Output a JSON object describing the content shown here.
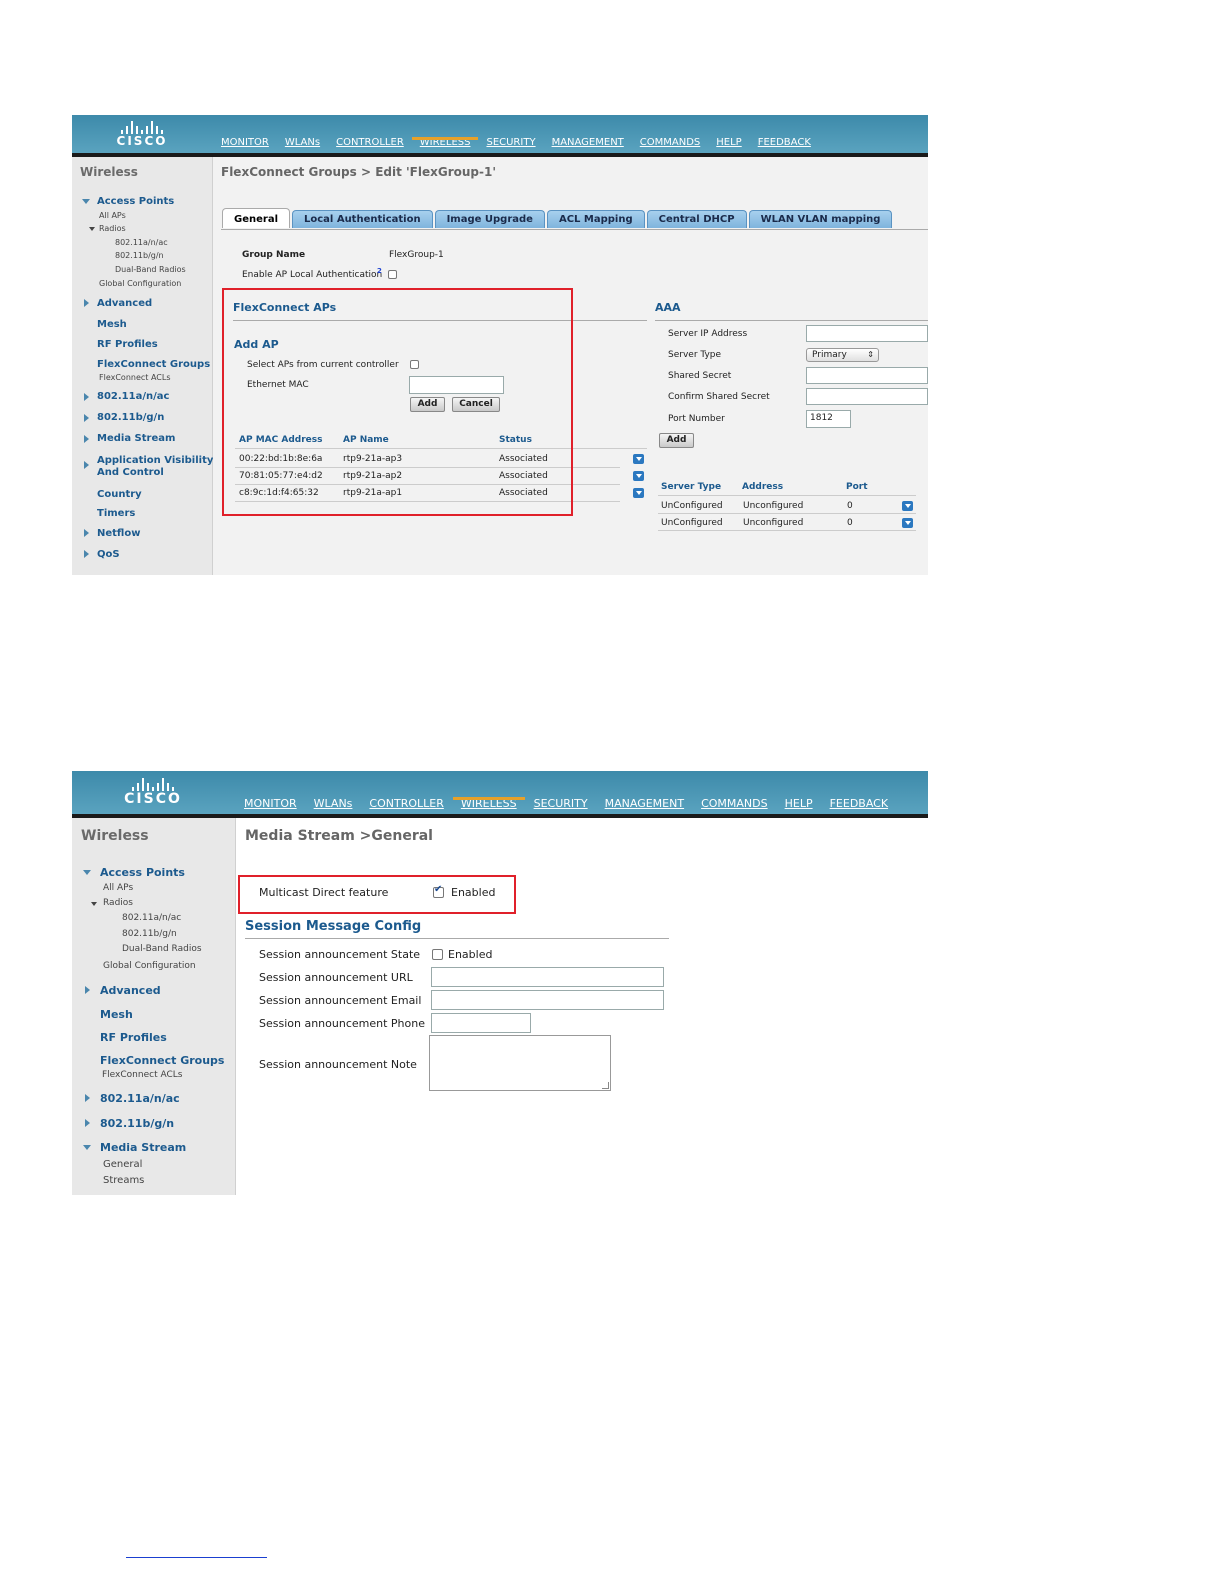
{
  "header": {
    "logo_text": "CISCO",
    "nav": [
      "MONITOR",
      "WLANs",
      "CONTROLLER",
      "WIRELESS",
      "SECURITY",
      "MANAGEMENT",
      "COMMANDS",
      "HELP",
      "FEEDBACK"
    ],
    "active_nav": "WIRELESS"
  },
  "sidebar": {
    "title": "Wireless",
    "access_points": "Access Points",
    "all_aps": "All APs",
    "radios": "Radios",
    "radio_ac": "802.11a/n/ac",
    "radio_bgn": "802.11b/g/n",
    "dual_band": "Dual-Band Radios",
    "global_config": "Global Configuration",
    "advanced": "Advanced",
    "mesh": "Mesh",
    "rf_profiles": "RF Profiles",
    "flexconnect_groups": "FlexConnect Groups",
    "flexconnect_acls": "FlexConnect ACLs",
    "band_a": "802.11a/n/ac",
    "band_b": "802.11b/g/n",
    "media_stream": "Media Stream",
    "app_visibility_1": "Application Visibility",
    "app_visibility_2": "And Control",
    "country": "Country",
    "timers": "Timers",
    "netflow": "Netflow",
    "qos": "QoS",
    "ms_general": "General",
    "ms_streams": "Streams"
  },
  "screen1": {
    "title": "FlexConnect Groups > Edit   'FlexGroup-1'",
    "tabs": [
      "General",
      "Local Authentication",
      "Image Upgrade",
      "ACL Mapping",
      "Central DHCP",
      "WLAN VLAN mapping"
    ],
    "group_name_label": "Group Name",
    "group_name_value": "FlexGroup-1",
    "enable_local_auth": "Enable AP Local Authentication",
    "footnote_mark": "2",
    "flexconnect_aps": "FlexConnect APs",
    "add_ap": "Add AP",
    "select_aps_label": "Select APs from current controller",
    "ethernet_mac_label": "Ethernet MAC",
    "add_button": "Add",
    "cancel_button": "Cancel",
    "table_headers": [
      "AP MAC Address",
      "AP Name",
      "Status"
    ],
    "table_rows": [
      [
        "00:22:bd:1b:8e:6a",
        "rtp9-21a-ap3",
        "Associated"
      ],
      [
        "70:81:05:77:e4:d2",
        "rtp9-21a-ap2",
        "Associated"
      ],
      [
        "c8:9c:1d:f4:65:32",
        "rtp9-21a-ap1",
        "Associated"
      ]
    ],
    "aaa": {
      "title": "AAA",
      "server_ip": "Server IP Address",
      "server_type": "Server Type",
      "server_type_value": "Primary",
      "shared_secret": "Shared Secret",
      "confirm_secret": "Confirm Shared Secret",
      "port_number": "Port Number",
      "port_value": "1812",
      "add_button": "Add",
      "headers": [
        "Server Type",
        "Address",
        "Port"
      ],
      "rows": [
        [
          "UnConfigured",
          "Unconfigured",
          "0"
        ],
        [
          "UnConfigured",
          "Unconfigured",
          "0"
        ]
      ]
    }
  },
  "screen2": {
    "title": "Media Stream >General",
    "multicast_label": "Multicast Direct feature",
    "multicast_enabled": "Enabled",
    "session_config_title": "Session Message Config",
    "state_label": "Session announcement State",
    "state_enabled": "Enabled",
    "url_label": "Session announcement URL",
    "email_label": "Session announcement Email",
    "phone_label": "Session announcement Phone",
    "note_label": "Session announcement Note"
  },
  "colors": {
    "header_blue": "#4a96b5",
    "active_underline": "#e6a12a",
    "link_blue": "#1c5a8e",
    "highlight_red": "#e0202a"
  }
}
